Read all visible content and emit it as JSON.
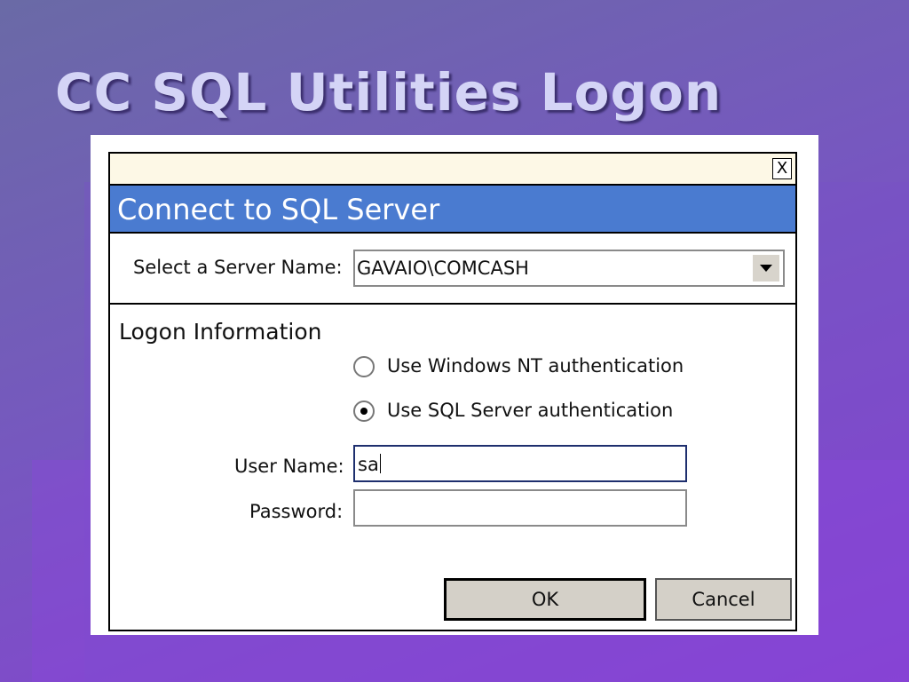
{
  "slide": {
    "title": "CC SQL Utilities Logon"
  },
  "dialog": {
    "close_glyph": "X",
    "header_title": "Connect to SQL Server",
    "server": {
      "label": "Select a Server Name:",
      "value": "GAVAIO\\COMCASH"
    },
    "logon": {
      "title": "Logon Information",
      "options": [
        {
          "label": "Use Windows NT authentication",
          "selected": false
        },
        {
          "label": "Use SQL Server authentication",
          "selected": true
        }
      ]
    },
    "user_name": {
      "label": "User Name:",
      "value": "sa"
    },
    "password": {
      "label": "Password:",
      "value": ""
    },
    "buttons": {
      "ok": "OK",
      "cancel": "Cancel"
    }
  },
  "colors": {
    "header_band": "#4a7bd0",
    "titlebar": "#fdf8e6",
    "slide_title": "#d4d4f6"
  },
  "icons": [
    "close-icon",
    "dropdown-arrow-icon",
    "radio-icon"
  ]
}
